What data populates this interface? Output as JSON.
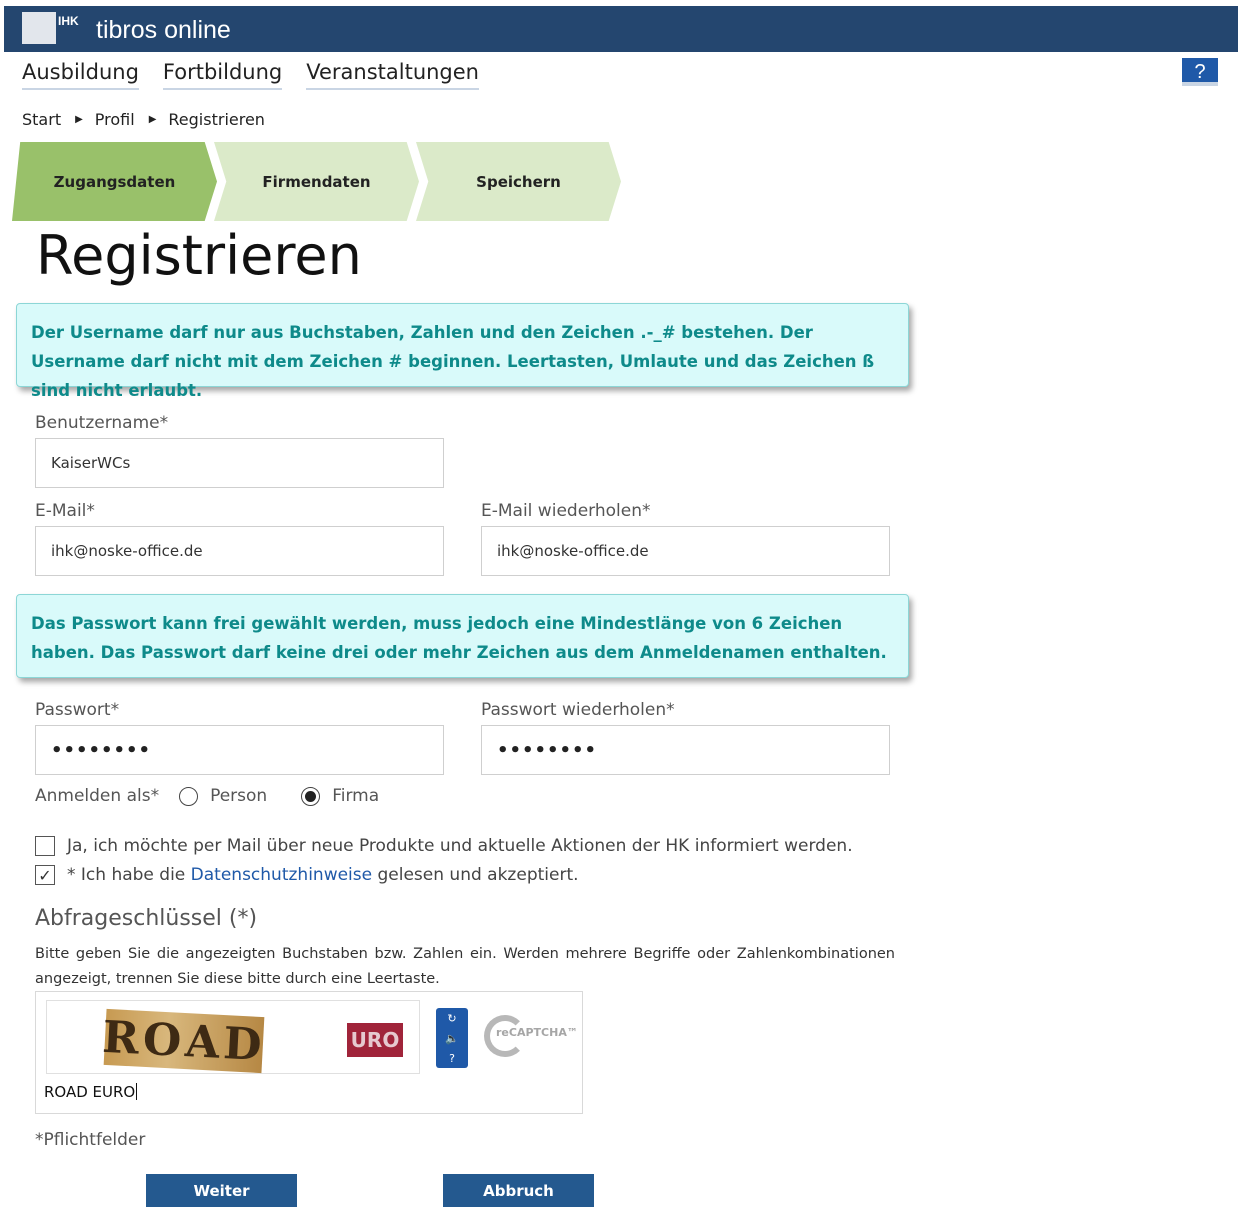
{
  "header": {
    "logo_text": "IHK",
    "app_title": "tibros online",
    "help_label": "?"
  },
  "nav": {
    "items": [
      "Ausbildung",
      "Fortbildung",
      "Veranstaltungen"
    ]
  },
  "breadcrumb": {
    "items": [
      "Start",
      "Profil",
      "Registrieren"
    ]
  },
  "steps": {
    "items": [
      {
        "label": "Zugangsdaten",
        "state": "active"
      },
      {
        "label": "Firmendaten",
        "state": "inactive"
      },
      {
        "label": "Speichern",
        "state": "inactive"
      }
    ]
  },
  "page_title": "Registrieren",
  "info": {
    "username_hint": "Der Username darf nur aus Buchstaben, Zahlen und den Zeichen .-_# bestehen. Der Username darf nicht mit dem Zeichen # beginnen. Leertasten, Umlaute und das Zeichen ß sind nicht erlaubt.",
    "password_hint": "Das Passwort kann frei gewählt werden, muss jedoch eine Mindestlänge von 6 Zeichen haben. Das Passwort darf keine drei oder mehr Zeichen aus dem Anmeldenamen enthalten."
  },
  "form": {
    "username_label": "Benutzername*",
    "username_value": "KaiserWCs",
    "email_label": "E-Mail*",
    "email_value": "ihk@noske-office.de",
    "email_repeat_label": "E-Mail wiederholen*",
    "email_repeat_value": "ihk@noske-office.de",
    "password_label": "Passwort*",
    "password_value": "••••••••",
    "password_repeat_label": "Passwort wiederholen*",
    "password_repeat_value": "••••••••",
    "register_as_label": "Anmelden als*",
    "option_person": "Person",
    "option_firma": "Firma",
    "selected_option": "Firma",
    "newsletter_label": "Ja, ich möchte per Mail über neue Produkte und aktuelle Aktionen der HK informiert werden.",
    "newsletter_checked": false,
    "privacy_prefix": "* Ich habe die",
    "privacy_link": "Datenschutzhinweise",
    "privacy_suffix": "gelesen und akzeptiert.",
    "privacy_checked": true
  },
  "captcha": {
    "title": "Abfrageschlüssel (*)",
    "description": "Bitte geben Sie die angezeigten Buchstaben bzw. Zahlen ein. Werden mehrere Begriffe oder Zahlenkombinationen angezeigt, trennen Sie diese bitte durch eine Leertaste.",
    "word1": "ROAD",
    "word2": "URO",
    "logo_text": "reCAPTCHA™",
    "input_value": "ROAD EURO"
  },
  "required_note": "*Pflichtfelder",
  "buttons": {
    "next": "Weiter",
    "cancel": "Abbruch"
  },
  "colors": {
    "header_bg": "#24466f",
    "step_active": "#99c16a",
    "step_inactive": "#dbeac9",
    "info_bg": "#d9fafa",
    "info_text": "#0e8a8a",
    "button_bg": "#24598f",
    "link": "#1f59a8"
  }
}
